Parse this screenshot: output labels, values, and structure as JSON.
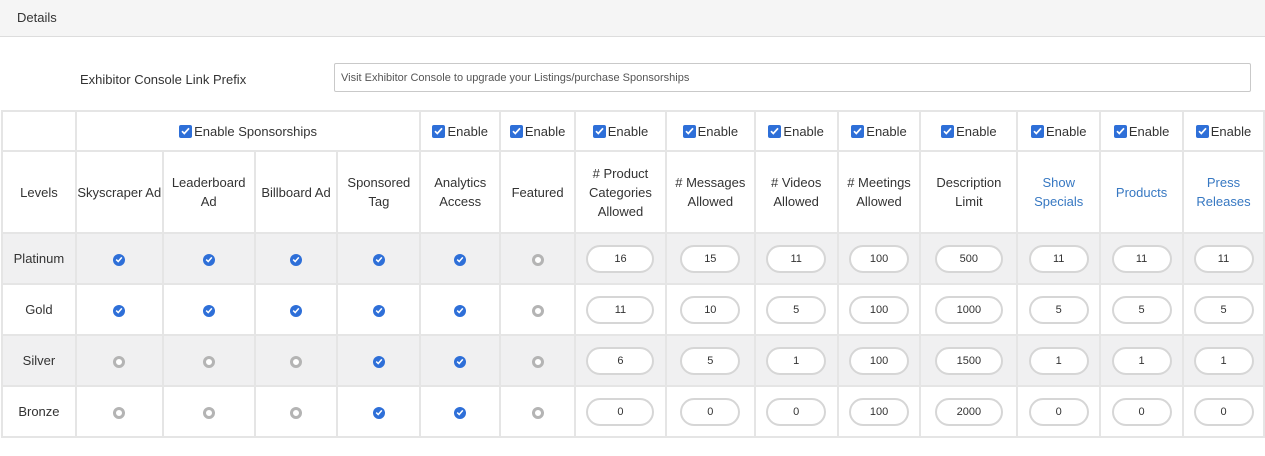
{
  "panel": {
    "title": "Details"
  },
  "prefix": {
    "label": "Exhibitor Console Link Prefix",
    "value": "Visit Exhibitor Console to upgrade your Listings/purchase Sponsorships"
  },
  "toggles": {
    "sponsorships": "Enable Sponsorships",
    "enable": "Enable"
  },
  "headers": {
    "levels": "Levels",
    "skyscraper": "Skyscraper Ad",
    "leaderboard": "Leaderboard Ad",
    "billboard": "Billboard Ad",
    "sponsored_tag": "Sponsored Tag",
    "analytics": "Analytics Access",
    "featured": "Featured",
    "product_categories": "# Product Categories Allowed",
    "messages": "# Messages Allowed",
    "videos": "# Videos Allowed",
    "meetings": "# Meetings Allowed",
    "description": "Description Limit",
    "show_specials": "Show Specials",
    "products": "Products",
    "press_releases": "Press Releases"
  },
  "levels": [
    {
      "name": "Platinum",
      "skyscraper": true,
      "leaderboard": true,
      "billboard": true,
      "sponsored_tag": true,
      "analytics": true,
      "featured": false,
      "product_categories": "16",
      "messages": "15",
      "videos": "11",
      "meetings": "100",
      "description": "500",
      "show_specials": "11",
      "products": "11",
      "press_releases": "11"
    },
    {
      "name": "Gold",
      "skyscraper": true,
      "leaderboard": true,
      "billboard": true,
      "sponsored_tag": true,
      "analytics": true,
      "featured": false,
      "product_categories": "11",
      "messages": "10",
      "videos": "5",
      "meetings": "100",
      "description": "1000",
      "show_specials": "5",
      "products": "5",
      "press_releases": "5"
    },
    {
      "name": "Silver",
      "skyscraper": false,
      "leaderboard": false,
      "billboard": false,
      "sponsored_tag": true,
      "analytics": true,
      "featured": false,
      "product_categories": "6",
      "messages": "5",
      "videos": "1",
      "meetings": "100",
      "description": "1500",
      "show_specials": "1",
      "products": "1",
      "press_releases": "1"
    },
    {
      "name": "Bronze",
      "skyscraper": false,
      "leaderboard": false,
      "billboard": false,
      "sponsored_tag": true,
      "analytics": true,
      "featured": false,
      "product_categories": "0",
      "messages": "0",
      "videos": "0",
      "meetings": "100",
      "description": "2000",
      "show_specials": "0",
      "products": "0",
      "press_releases": "0"
    }
  ],
  "colors": {
    "accent": "#2e6fd8",
    "link": "#3778c2",
    "radio_off": "#b4b4b4"
  },
  "icons": {
    "checkbox": "checkbox-checked-icon",
    "radio_on": "radio-checked-icon",
    "radio_off": "radio-unchecked-icon"
  }
}
